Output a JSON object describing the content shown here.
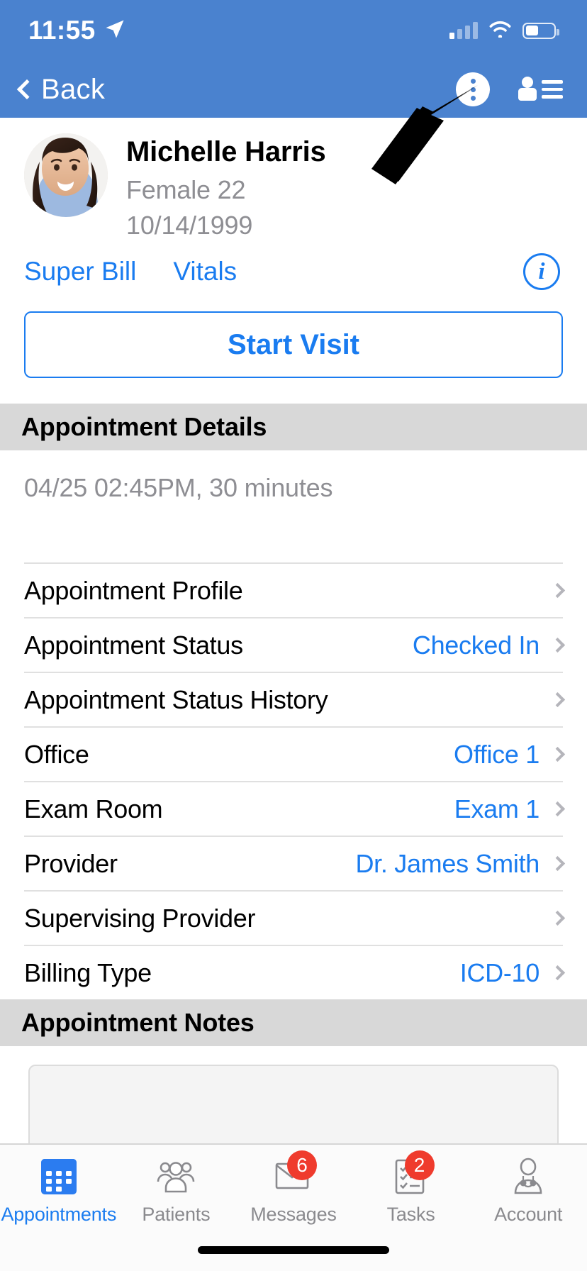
{
  "status_bar": {
    "time": "11:55",
    "location_icon": "location-arrow-icon",
    "signal_icon": "cellular-signal-icon",
    "wifi_icon": "wifi-icon",
    "battery_icon": "battery-icon"
  },
  "navbar": {
    "back_label": "Back",
    "back_icon": "chevron-left-icon",
    "overflow_icon": "kebab-menu-icon",
    "patient_list_icon": "person-list-icon"
  },
  "patient": {
    "name": "Michelle Harris",
    "gender_age": "Female 22",
    "dob": "10/14/1999",
    "avatar_icon": "patient-avatar",
    "links": [
      {
        "label": "Super Bill"
      },
      {
        "label": "Vitals"
      }
    ],
    "info_icon": "info-icon",
    "info_glyph": "i",
    "start_visit_label": "Start Visit"
  },
  "appointment_details": {
    "section_title": "Appointment Details",
    "time_summary": "04/25 02:45PM, 30 minutes",
    "rows": [
      {
        "label": "Appointment Profile",
        "value": ""
      },
      {
        "label": "Appointment Status",
        "value": "Checked In"
      },
      {
        "label": "Appointment Status History",
        "value": ""
      },
      {
        "label": "Office",
        "value": "Office 1"
      },
      {
        "label": "Exam Room",
        "value": "Exam 1"
      },
      {
        "label": "Provider",
        "value": "Dr. James Smith"
      },
      {
        "label": "Supervising Provider",
        "value": ""
      },
      {
        "label": "Billing Type",
        "value": "ICD-10"
      }
    ]
  },
  "appointment_notes": {
    "section_title": "Appointment Notes",
    "note_value": "",
    "note_placeholder": ""
  },
  "tabbar": {
    "items": [
      {
        "label": "Appointments",
        "icon": "calendar-icon",
        "badge": "",
        "active": true
      },
      {
        "label": "Patients",
        "icon": "people-icon",
        "badge": "",
        "active": false
      },
      {
        "label": "Messages",
        "icon": "envelope-icon",
        "badge": "6",
        "active": false
      },
      {
        "label": "Tasks",
        "icon": "checklist-icon",
        "badge": "2",
        "active": false
      },
      {
        "label": "Account",
        "icon": "doctor-icon",
        "badge": "",
        "active": false
      }
    ]
  },
  "annotation": {
    "arrow_icon": "pointer-arrow-annotation"
  },
  "colors": {
    "brand_blue": "#4a82cf",
    "link_blue": "#1a7cf0",
    "section_gray": "#d8d8d8",
    "muted_text": "#8e8e93",
    "badge_red": "#ef3b2d"
  }
}
